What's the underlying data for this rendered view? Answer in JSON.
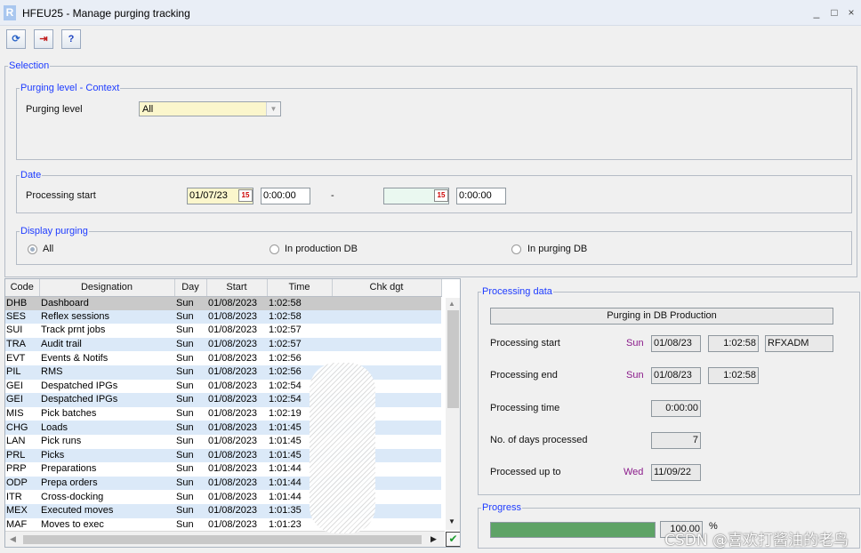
{
  "window": {
    "title": "HFEU25 - Manage purging tracking",
    "logo": "R",
    "controls": {
      "minimize": "_",
      "maximize": "□",
      "close": "×"
    }
  },
  "toolbar": {
    "buttons": [
      {
        "icon": "refresh-icon",
        "glyph": "⟳"
      },
      {
        "icon": "exit-icon",
        "glyph": "⇥"
      },
      {
        "icon": "help-icon",
        "glyph": "?"
      }
    ]
  },
  "selection": {
    "legend": "Selection",
    "context": {
      "legend": "Purging level - Context",
      "purging_level_label": "Purging level",
      "purging_level_value": "All"
    },
    "date": {
      "legend": "Date",
      "processing_start_label": "Processing start",
      "from_date": "01/07/23",
      "from_time": "0:00:00",
      "separator": "-",
      "to_date": "",
      "to_time": "0:00:00",
      "cal_glyph": "15"
    },
    "display": {
      "legend": "Display purging",
      "options": [
        "All",
        "In production DB",
        "In purging DB"
      ],
      "selected": "All"
    }
  },
  "grid": {
    "columns": [
      "Code",
      "Designation",
      "Day",
      "Start",
      "Time",
      "Chk dgt"
    ],
    "rows": [
      [
        "DHB",
        "Dashboard",
        "Sun",
        "01/08/2023",
        "1:02:58",
        ""
      ],
      [
        "SES",
        "Reflex sessions",
        "Sun",
        "01/08/2023",
        "1:02:58",
        ""
      ],
      [
        "SUI",
        "Track prnt jobs",
        "Sun",
        "01/08/2023",
        "1:02:57",
        ""
      ],
      [
        "TRA",
        "Audit trail",
        "Sun",
        "01/08/2023",
        "1:02:57",
        ""
      ],
      [
        "EVT",
        "Events & Notifs",
        "Sun",
        "01/08/2023",
        "1:02:56",
        ""
      ],
      [
        "PIL",
        "RMS",
        "Sun",
        "01/08/2023",
        "1:02:56",
        ""
      ],
      [
        "GEI",
        "Despatched IPGs",
        "Sun",
        "01/08/2023",
        "1:02:54",
        ""
      ],
      [
        "GEI",
        "Despatched IPGs",
        "Sun",
        "01/08/2023",
        "1:02:54",
        ""
      ],
      [
        "MIS",
        "Pick batches",
        "Sun",
        "01/08/2023",
        "1:02:19",
        ""
      ],
      [
        "CHG",
        "Loads",
        "Sun",
        "01/08/2023",
        "1:01:45",
        ""
      ],
      [
        "LAN",
        "Pick runs",
        "Sun",
        "01/08/2023",
        "1:01:45",
        ""
      ],
      [
        "PRL",
        "Picks",
        "Sun",
        "01/08/2023",
        "1:01:45",
        ""
      ],
      [
        "PRP",
        "Preparations",
        "Sun",
        "01/08/2023",
        "1:01:44",
        ""
      ],
      [
        "ODP",
        "Prepa orders",
        "Sun",
        "01/08/2023",
        "1:01:44",
        ""
      ],
      [
        "ITR",
        "Cross-docking",
        "Sun",
        "01/08/2023",
        "1:01:44",
        ""
      ],
      [
        "MEX",
        "Executed moves",
        "Sun",
        "01/08/2023",
        "1:01:35",
        ""
      ],
      [
        "MAF",
        "Moves to exec",
        "Sun",
        "01/08/2023",
        "1:01:23",
        ""
      ]
    ],
    "check_glyph": "✔"
  },
  "processing": {
    "legend": "Processing data",
    "banner": "Purging in DB Production",
    "start_label": "Processing start",
    "start_day": "Sun",
    "start_date": "01/08/23",
    "start_time": "1:02:58",
    "start_user": "RFXADM",
    "end_label": "Processing end",
    "end_day": "Sun",
    "end_date": "01/08/23",
    "end_time": "1:02:58",
    "time_label": "Processing time",
    "time_value": "0:00:00",
    "days_label": "No. of days processed",
    "days_value": "7",
    "upto_label": "Processed up to",
    "upto_day": "Wed",
    "upto_date": "11/09/22"
  },
  "progress": {
    "legend": "Progress",
    "value_text": "100.00",
    "unit": "%",
    "fraction": 1.0
  },
  "watermark": "CSDN @喜欢打酱油的老鸟",
  "colors": {
    "legend": "#1e3cff",
    "day_purple": "#8a1a8a",
    "progress_fill": "#5ea366",
    "row_alt": "#dbe9f8",
    "row_selected": "#c9c9c9"
  }
}
